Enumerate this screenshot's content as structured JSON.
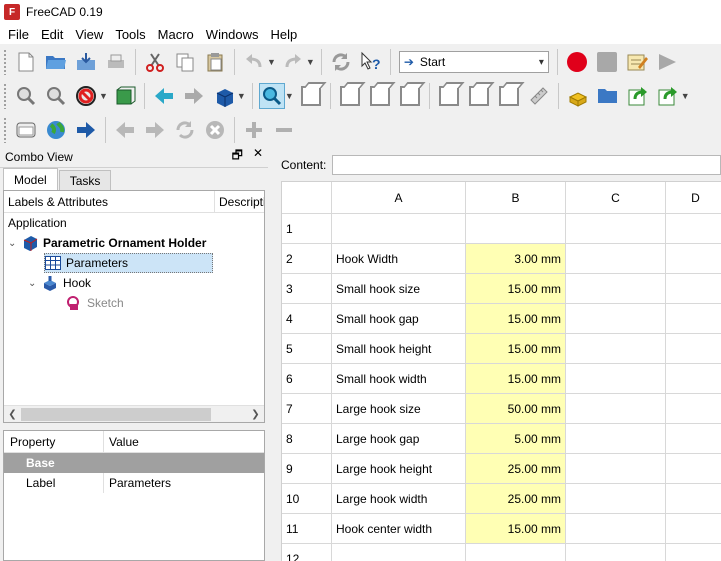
{
  "window": {
    "title": "FreeCAD 0.19",
    "icon": "freecad-app-icon"
  },
  "menu": [
    "File",
    "Edit",
    "View",
    "Tools",
    "Macro",
    "Windows",
    "Help"
  ],
  "toolbar": {
    "workbench_selected": "Start"
  },
  "combo_view": {
    "title": "Combo View",
    "tabs": [
      "Model",
      "Tasks"
    ],
    "tree": {
      "col_labels": "Labels & Attributes",
      "col_description": "Description",
      "root": "Application",
      "document": "Parametric Ornament Holder",
      "items": [
        {
          "label": "Parameters",
          "icon": "spreadsheet-icon"
        },
        {
          "label": "Hook",
          "icon": "body-icon"
        },
        {
          "label": "Sketch",
          "icon": "sketch-icon"
        }
      ]
    },
    "property": {
      "col_property": "Property",
      "col_value": "Value",
      "group": "Base",
      "rows": [
        {
          "name": "Label",
          "value": "Parameters"
        }
      ]
    }
  },
  "content": {
    "label": "Content:",
    "value": ""
  },
  "sheet": {
    "columns": [
      "A",
      "B",
      "C",
      "D"
    ],
    "rows": [
      {
        "num": "1",
        "a": "",
        "b": ""
      },
      {
        "num": "2",
        "a": "Hook Width",
        "b": "3.00 mm"
      },
      {
        "num": "3",
        "a": "Small hook size",
        "b": "15.00 mm"
      },
      {
        "num": "4",
        "a": "Small hook gap",
        "b": "15.00 mm"
      },
      {
        "num": "5",
        "a": "Small hook height",
        "b": "15.00 mm"
      },
      {
        "num": "6",
        "a": "Small hook width",
        "b": "15.00 mm"
      },
      {
        "num": "7",
        "a": "Large hook size",
        "b": "50.00 mm"
      },
      {
        "num": "8",
        "a": "Large hook gap",
        "b": "5.00 mm"
      },
      {
        "num": "9",
        "a": "Large hook height",
        "b": "25.00 mm"
      },
      {
        "num": "10",
        "a": "Large hook width",
        "b": "25.00 mm"
      },
      {
        "num": "11",
        "a": "Hook center width",
        "b": "15.00 mm"
      },
      {
        "num": "12",
        "a": "",
        "b": ""
      }
    ]
  }
}
